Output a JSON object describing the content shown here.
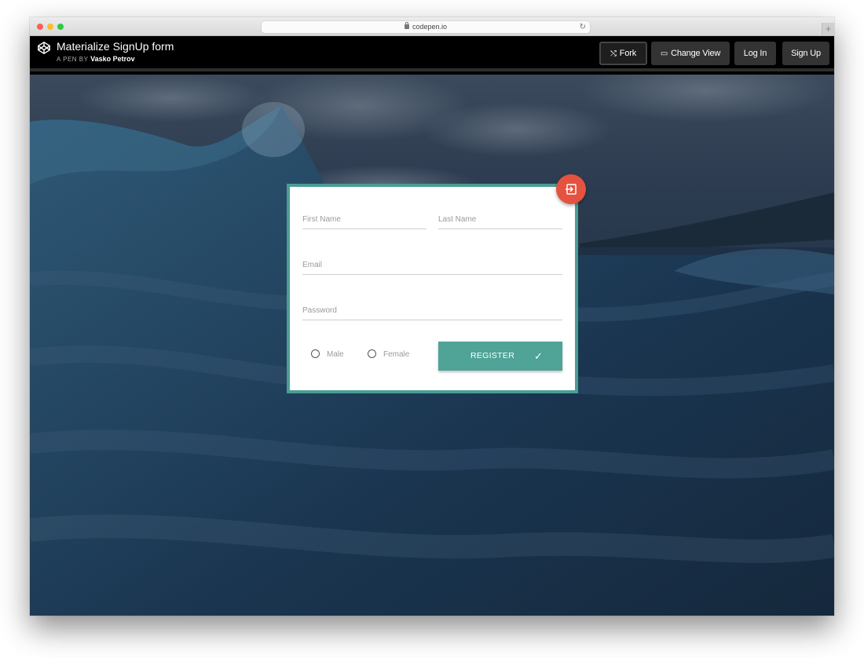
{
  "browser": {
    "url": "codepen.io",
    "new_tab_label": "+"
  },
  "header": {
    "pen_title": "Materialize SignUp form",
    "author_prefix": "A PEN BY",
    "author_name": "Vasko Petrov",
    "buttons": {
      "fork": "Fork",
      "change_view": "Change View",
      "log_in": "Log In",
      "sign_up": "Sign Up"
    }
  },
  "form": {
    "first_name_label": "First Name",
    "last_name_label": "Last Name",
    "email_label": "Email",
    "password_label": "Password",
    "gender_options": [
      "Male",
      "Female"
    ],
    "register_label": "REGISTER",
    "fab_icon": "signin-icon",
    "accent_color": "#4fa397",
    "fab_color": "#e4533f"
  }
}
